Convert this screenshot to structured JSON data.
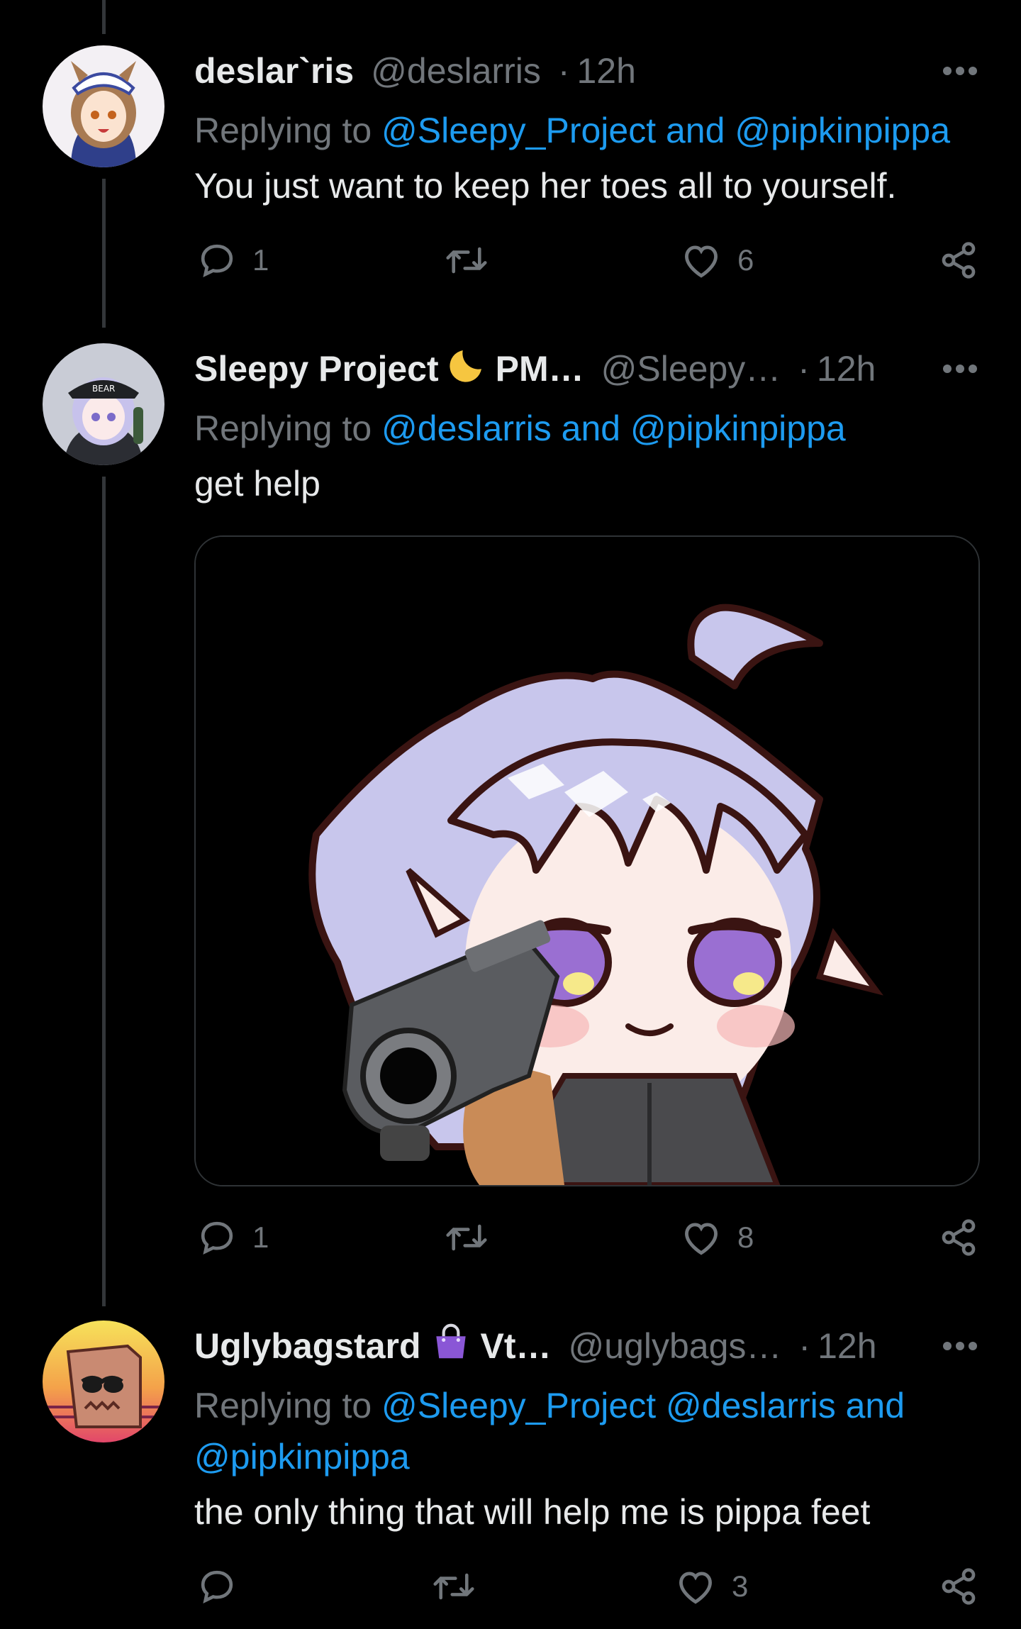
{
  "tweets": [
    {
      "display_name": "deslar`ris",
      "handle": "@deslarris",
      "dot": "·",
      "time": "12h",
      "replying_prefix": "Replying to ",
      "mentions_line": "@Sleepy_Project and @pipkinpippa",
      "text": "You just want to keep her toes all to yourself.",
      "replies": "1",
      "retweets": "",
      "likes": "6"
    },
    {
      "display_name": "Sleepy Project",
      "name_suffix": "PM…",
      "emoji": "crescent-moon-icon",
      "handle": "@Sleepy…",
      "dot": "·",
      "time": "12h",
      "replying_prefix": "Replying to ",
      "mentions_line": "@deslarris and @pipkinpippa",
      "text": "get help",
      "replies": "1",
      "retweets": "",
      "likes": "8"
    },
    {
      "display_name": "Uglybagstard",
      "name_suffix": "Vt…",
      "emoji": "purse-icon",
      "handle": "@uglybags…",
      "dot": "·",
      "time": "12h",
      "replying_prefix": "Replying to ",
      "mentions_line": "@Sleepy_Project @deslarris and",
      "mentions_line2": "@pipkinpippa",
      "text": "the only thing that will help me is pippa feet",
      "replies": "",
      "retweets": "",
      "likes": "3"
    }
  ],
  "colors": {
    "background": "#000000",
    "text": "#e7e9ea",
    "muted": "#71767b",
    "link": "#1d9bf0",
    "thread_line": "#333639"
  }
}
